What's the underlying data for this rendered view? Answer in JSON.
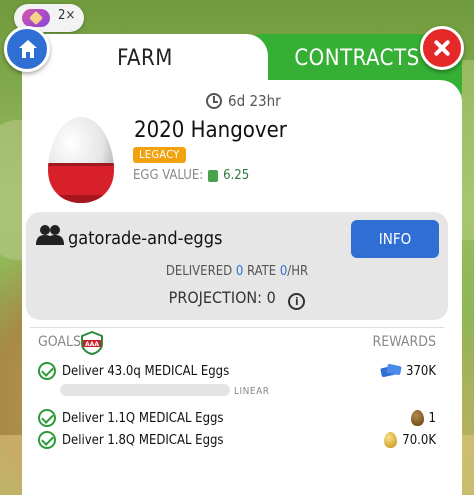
{
  "header": {
    "multiplier": "2×"
  },
  "tabs": [
    {
      "label": "FARM",
      "active": true
    },
    {
      "label": "CONTRACTS",
      "active": false
    }
  ],
  "contract": {
    "time_left": "6d 23hr",
    "name": "2020 Hangover",
    "badge": "LEGACY",
    "egg_value_label": "EGG VALUE:",
    "egg_value": "6.25"
  },
  "coop": {
    "name": "gatorade-and-eggs",
    "info_button": "INFO",
    "delivered_label": "DELIVERED",
    "delivered_value": "0",
    "rate_label": "RATE",
    "rate_value": "0",
    "rate_unit": "/HR",
    "projection_label": "PROJECTION:",
    "projection_value": "0"
  },
  "goals": {
    "label": "GOALS",
    "grade": "AAA",
    "rewards_label": "REWARDS",
    "progress_mode": "LINEAR",
    "progress_fraction": 0,
    "items": [
      {
        "text": "Deliver 43.0q MEDICAL Eggs",
        "reward": "370K",
        "reward_icon": "tickets-icon"
      },
      {
        "text": "Deliver 1.1Q MEDICAL Eggs",
        "reward": "1",
        "reward_icon": "dark-golden-egg-icon"
      },
      {
        "text": "Deliver 1.8Q MEDICAL Eggs",
        "reward": "70.0K",
        "reward_icon": "golden-egg-icon"
      }
    ]
  },
  "colors": {
    "farm_tab": "#ffffff",
    "contracts_tab": "#35b034",
    "info_button": "#2f6fd3",
    "legacy_badge": "#f2a20f",
    "close_button": "#e52828"
  }
}
